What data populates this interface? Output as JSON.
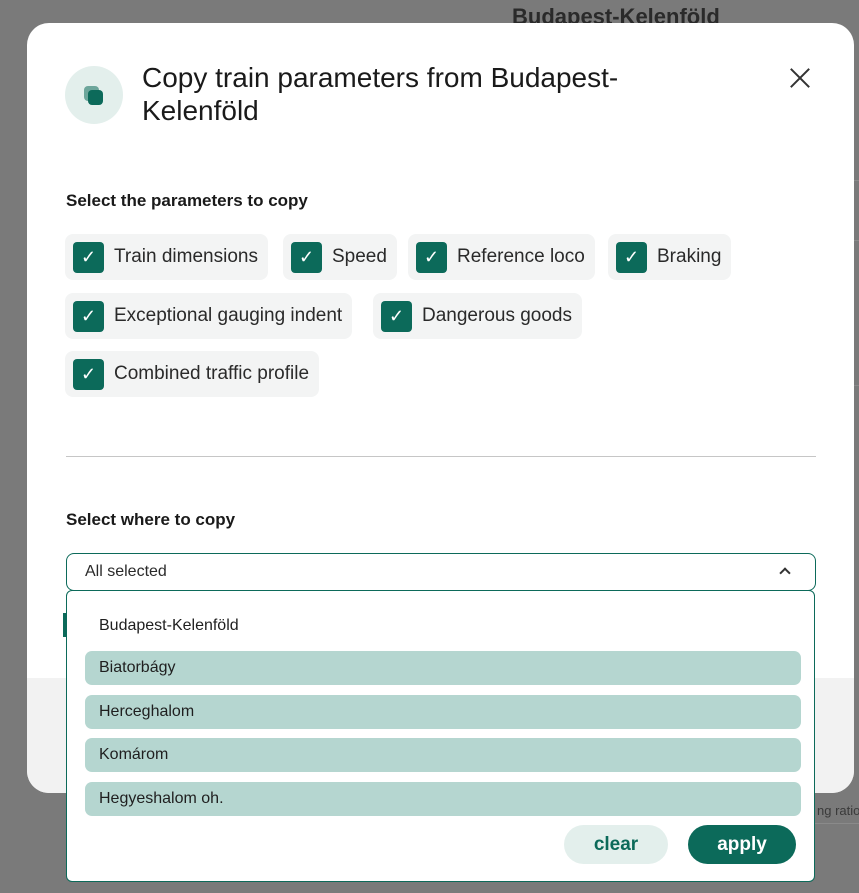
{
  "background": {
    "title": "Budapest-Kelenföld",
    "snippet": "ng ratio"
  },
  "modal": {
    "title": "Copy train parameters from Budapest-Kelenföld",
    "header_icon": "copy-icon",
    "close_icon": "close-icon"
  },
  "parameters": {
    "label": "Select the parameters to copy",
    "items": [
      {
        "label": "Train dimensions",
        "checked": true
      },
      {
        "label": "Speed",
        "checked": true
      },
      {
        "label": "Reference loco",
        "checked": true
      },
      {
        "label": "Braking",
        "checked": true
      },
      {
        "label": "Exceptional gauging indent",
        "checked": true
      },
      {
        "label": "Dangerous goods",
        "checked": true
      },
      {
        "label": "Combined traffic profile",
        "checked": true
      }
    ],
    "check_glyph": "✓"
  },
  "destination": {
    "label": "Select where to copy",
    "value": "All selected",
    "options": [
      {
        "label": "Budapest-Kelenföld",
        "selected": false
      },
      {
        "label": "Biatorbágy",
        "selected": true
      },
      {
        "label": "Herceghalom",
        "selected": true
      },
      {
        "label": "Komárom",
        "selected": true
      },
      {
        "label": "Hegyeshalom oh.",
        "selected": true
      }
    ],
    "clear_label": "clear",
    "apply_label": "apply"
  },
  "colors": {
    "accent": "#0c6a5a",
    "selected_option": "#b5d6d0",
    "chip_bg": "#f3f4f4"
  }
}
